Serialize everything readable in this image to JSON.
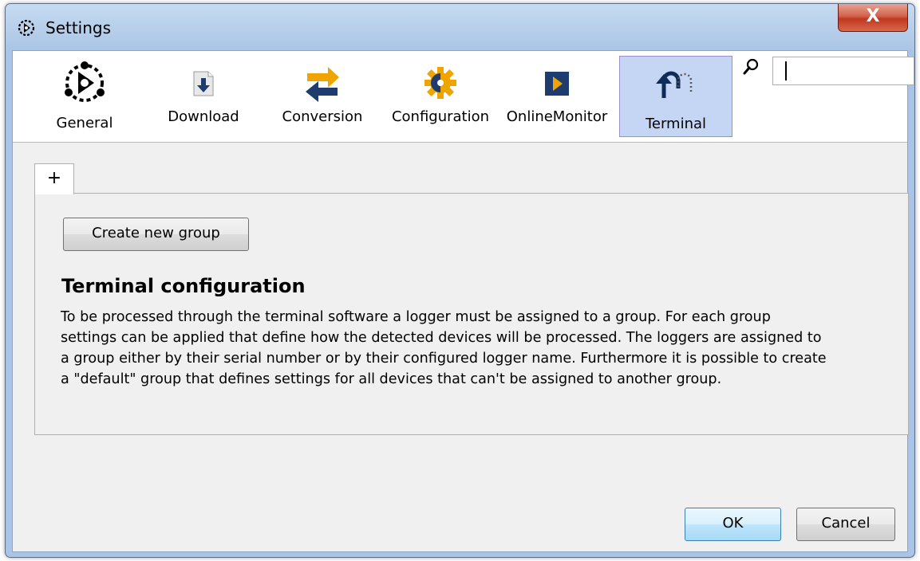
{
  "window": {
    "title": "Settings",
    "close_label": "X"
  },
  "toolbar": {
    "items": [
      {
        "label": "General",
        "icon": "general-icon"
      },
      {
        "label": "Download",
        "icon": "download-icon"
      },
      {
        "label": "Conversion",
        "icon": "conversion-icon"
      },
      {
        "label": "Configuration",
        "icon": "configuration-icon"
      },
      {
        "label": "OnlineMonitor",
        "icon": "online-monitor-icon"
      },
      {
        "label": "Terminal",
        "icon": "terminal-icon",
        "selected": true
      }
    ],
    "search": {
      "value": ""
    }
  },
  "tabs": [
    {
      "label": "+"
    }
  ],
  "content": {
    "create_button": "Create new group",
    "heading": "Terminal configuration",
    "lines": [
      "To be processed through the terminal software a logger must be assigned to a group. For each group",
      "settings can be applied that define how the detected devices will be processed. The loggers are assigned to",
      "a group either by their serial number or by their configured logger name. Furthermore it is possible to create",
      "a \"default\" group that defines settings for all devices that can't be assigned to another group."
    ]
  },
  "footer": {
    "ok_label": "OK",
    "cancel_label": "Cancel"
  },
  "colors": {
    "accent": "#1e5fb4",
    "orange": "#f0a400",
    "selected_bg": "#c5d6f5"
  }
}
